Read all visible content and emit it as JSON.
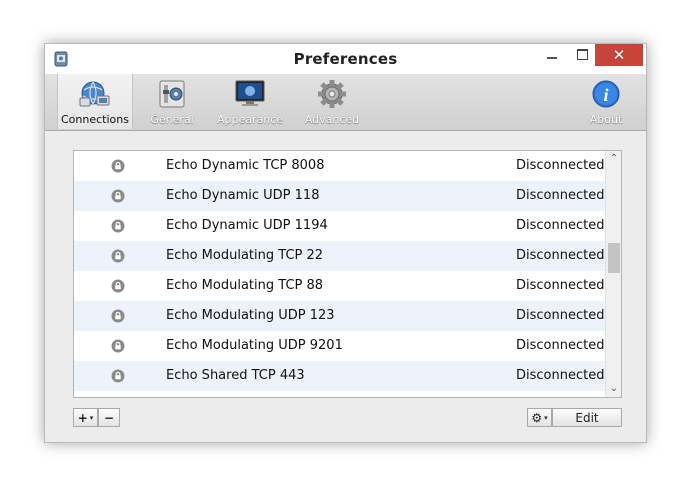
{
  "window": {
    "title": "Preferences",
    "close_glyph": "✕"
  },
  "toolbar": {
    "items": [
      {
        "label": "Connections",
        "icon": "connections-icon",
        "active": true
      },
      {
        "label": "General",
        "icon": "general-icon",
        "active": false
      },
      {
        "label": "Appearance",
        "icon": "appearance-icon",
        "active": false
      },
      {
        "label": "Advanced",
        "icon": "advanced-gear-icon",
        "active": false
      },
      {
        "label": "About",
        "icon": "info-icon",
        "active": false
      }
    ]
  },
  "connections": [
    {
      "name": "Echo Dynamic TCP 8008",
      "status": "Disconnected"
    },
    {
      "name": "Echo Dynamic UDP 118",
      "status": "Disconnected"
    },
    {
      "name": "Echo Dynamic UDP 1194",
      "status": "Disconnected"
    },
    {
      "name": "Echo Modulating TCP 22",
      "status": "Disconnected"
    },
    {
      "name": "Echo Modulating TCP 88",
      "status": "Disconnected"
    },
    {
      "name": "Echo Modulating UDP 123",
      "status": "Disconnected"
    },
    {
      "name": "Echo Modulating UDP 9201",
      "status": "Disconnected"
    },
    {
      "name": "Echo Shared TCP 443",
      "status": "Disconnected"
    }
  ],
  "footer": {
    "add_label": "+",
    "add_caret": "▾",
    "remove_label": "−",
    "gear_glyph": "⚙",
    "gear_caret": "▾",
    "edit_label": "Edit"
  },
  "scrollbar": {
    "up": "⌃",
    "down": "⌄"
  },
  "colors": {
    "close_button": "#c7443a",
    "row_alt": "#eef3fb",
    "info_blue": "#2a72d6"
  }
}
